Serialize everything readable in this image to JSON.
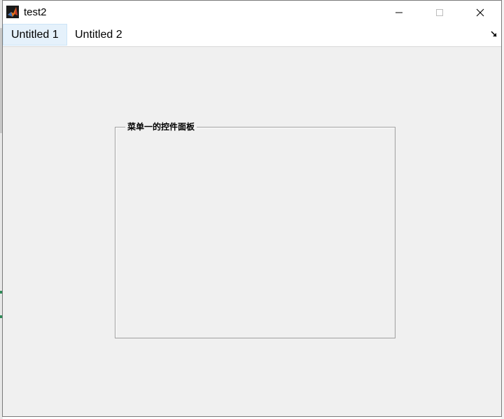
{
  "window": {
    "title": "test2",
    "app_icon": "matlab-icon",
    "controls": {
      "minimize": "minimize-icon",
      "maximize": "maximize-icon",
      "close": "close-icon"
    }
  },
  "menubar": {
    "tabs": [
      {
        "label": "Untitled 1",
        "active": true
      },
      {
        "label": "Untitled 2",
        "active": false
      }
    ],
    "overflow_icon": "corner-arrow-icon"
  },
  "panel": {
    "title": "菜单一的控件面板"
  },
  "colors": {
    "window_bg": "#f0f0f0",
    "titlebar_bg": "#ffffff",
    "active_tab_bg": "#e5f1fb",
    "panel_border": "#a0a0a0"
  }
}
